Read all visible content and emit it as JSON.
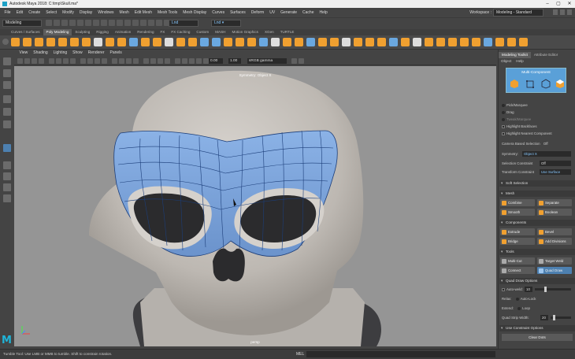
{
  "titlebar": {
    "title": "Autodesk Maya 2018: C:\\tmp\\Skull.ma*"
  },
  "menu": [
    "File",
    "Edit",
    "Create",
    "Select",
    "Modify",
    "Display",
    "Windows",
    "Mesh",
    "Edit Mesh",
    "Mesh Tools",
    "Mesh Display",
    "Curves",
    "Surfaces",
    "Deform",
    "UV",
    "Generate",
    "Cache",
    "Help"
  ],
  "workspace": {
    "label": "Workspace :",
    "value": "Modeling - Standard"
  },
  "statusline": {
    "mode": "Modeling",
    "field1": "Lnd",
    "field2": "Lnd ▾"
  },
  "shelf_tabs": [
    "Curves / Surfaces",
    "Poly Modeling",
    "Sculpting",
    "Rigging",
    "Animation",
    "Rendering",
    "FX",
    "FX Caching",
    "Custom",
    "MASH",
    "Motion Graphics",
    "XGen",
    "TURTLE"
  ],
  "shelf_active": "Poly Modeling",
  "viewport_menu": [
    "View",
    "Shading",
    "Lighting",
    "Show",
    "Renderer",
    "Panels"
  ],
  "viewport_toolbar": {
    "value_a": "0.00",
    "value_b": "1.00",
    "color_space": "sRGB gamma"
  },
  "viewport": {
    "label": "Symmetry: Object X",
    "camera": "persp"
  },
  "helpline": {
    "message": "Tumble Tool: Use LMB or MMB to tumble. Shift to constrain rotation.",
    "mel": "MEL"
  },
  "right_panel": {
    "tabs": [
      "Modeling Toolkit",
      "Attribute Editor"
    ],
    "sub_menu": [
      "Object",
      "Help"
    ],
    "multi_component": "Multi-Component",
    "options": [
      {
        "label": "Pick/Marquee",
        "type": "radio"
      },
      {
        "label": "Drag",
        "type": "radio"
      },
      {
        "label": "Tweak/Marquee",
        "type": "radio"
      },
      {
        "label": "Highlight Backfaces",
        "type": "check"
      },
      {
        "label": "Highlight Nearest Component",
        "type": "check"
      }
    ],
    "camera_based": {
      "label": "Camera Based Selection",
      "value": "Off"
    },
    "symmetry": {
      "label": "Symmetry:",
      "value": "Object X"
    },
    "selection_constraint": {
      "label": "Selection Constraint",
      "value": "Off"
    },
    "transform_constraint": {
      "label": "Transform Constraint",
      "value": "Use Surface"
    },
    "sections": {
      "soft_selection": "Soft Selection",
      "mesh": "Mesh",
      "components": "Components",
      "tools": "Tools",
      "quad_draw": "Quad Draw Options",
      "constraint": "Use Constraint Options"
    },
    "mesh_buttons": [
      "Combine",
      "Separate",
      "Smooth",
      "Boolean"
    ],
    "component_buttons": [
      "Extrude",
      "Bevel",
      "Bridge",
      "Add Divisions"
    ],
    "tool_buttons": [
      "Multi-Cut",
      "Target Weld",
      "Connect",
      "Quad Draw"
    ],
    "active_tool": "Quad Draw",
    "quad_draw": {
      "auto_weld_label": "Auto-weld:",
      "auto_weld_value": "10",
      "relax_label": "Relax:",
      "relax_value": "Auto-Lock",
      "extend_label": "Extend:",
      "extend_value": "Loop",
      "strip_label": "Quad Strip Width:",
      "strip_value": "20"
    },
    "clear_dots": "Clear Dots"
  }
}
